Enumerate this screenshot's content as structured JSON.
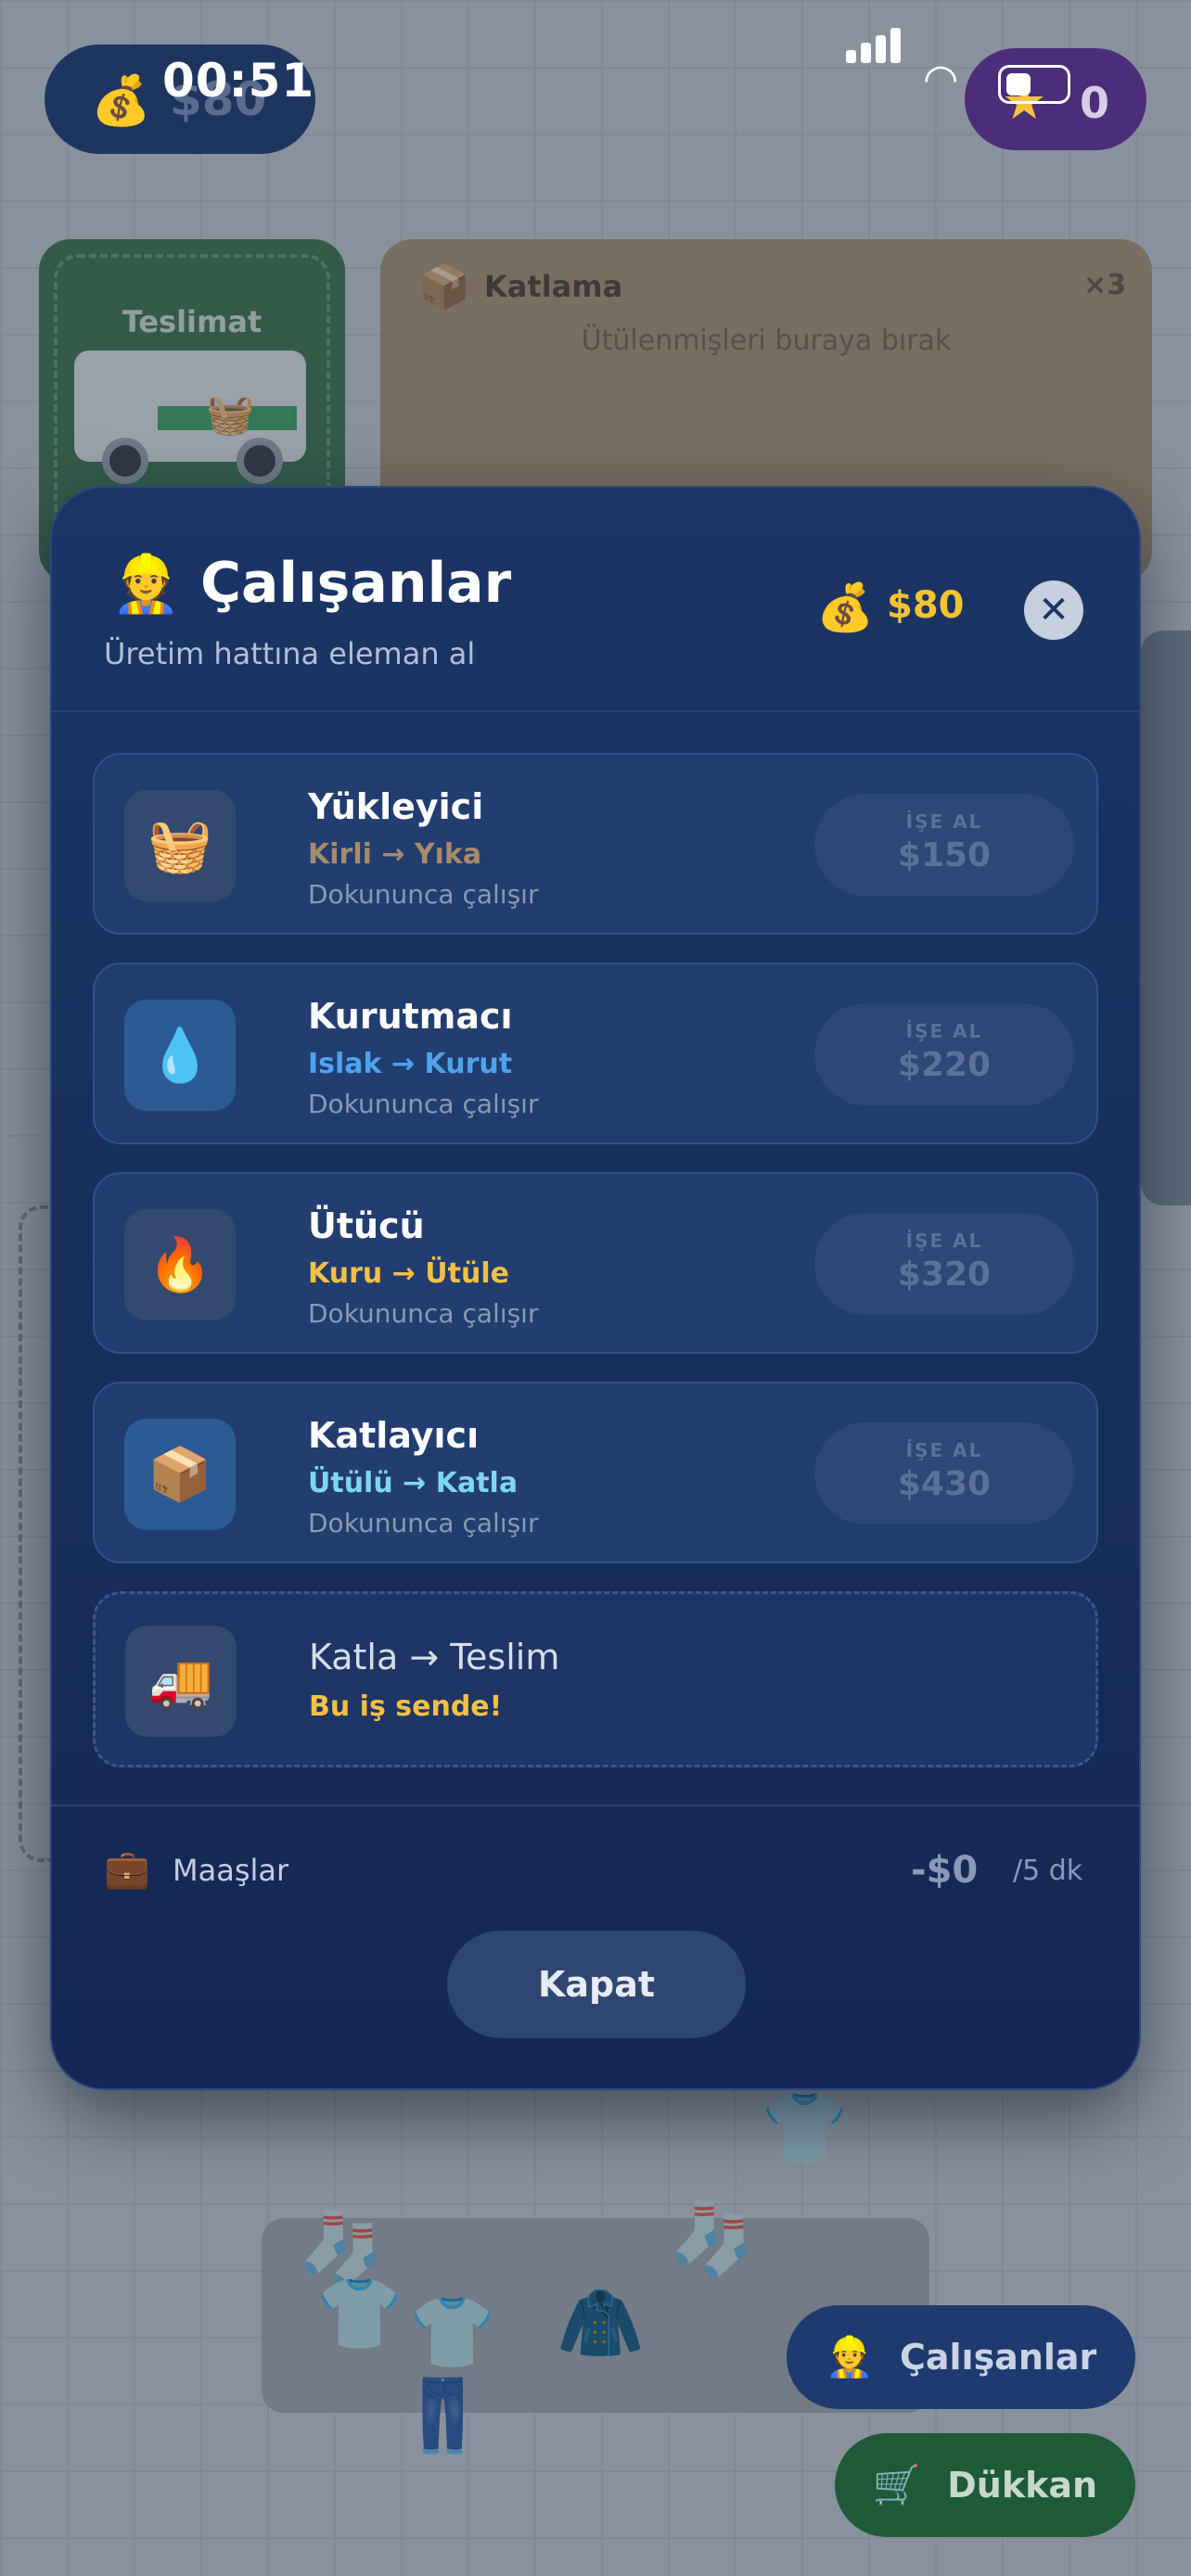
{
  "status_bar": {
    "time": "00:51",
    "money_ghost": "$80",
    "stars": "0"
  },
  "background": {
    "delivery_title": "Teslimat",
    "folding_title": "Katlama",
    "folding_multiplier": "×3",
    "folding_hint": "Ütülenmişleri buraya bırak"
  },
  "modal": {
    "title": "Çalışanlar",
    "subtitle": "Üretim hattına eleman al",
    "money": "$80",
    "close_symbol": "✕",
    "workers": [
      {
        "icon": "basket-icon",
        "glyph": "🧺",
        "name": "Yükleyici",
        "flow": "Kirli → Yıka",
        "flow_color": "#a78b6a",
        "note": "Dokununca çalışır",
        "hire_label": "İŞE AL",
        "price": "$150"
      },
      {
        "icon": "droplet-icon",
        "glyph": "💧",
        "name": "Kurutmacı",
        "flow": "Islak → Kurut",
        "flow_color": "#4ea3ee",
        "note": "Dokununca çalışır",
        "hire_label": "İŞE AL",
        "price": "$220"
      },
      {
        "icon": "fire-icon",
        "glyph": "🔥",
        "name": "Ütücü",
        "flow": "Kuru → Ütüle",
        "flow_color": "#f2c042",
        "note": "Dokununca çalışır",
        "hire_label": "İŞE AL",
        "price": "$320"
      },
      {
        "icon": "box-icon",
        "glyph": "📦",
        "name": "Katlayıcı",
        "flow": "Ütülü → Katla",
        "flow_color": "#7fd6f2",
        "note": "Dokununca çalışır",
        "hire_label": "İŞE AL",
        "price": "$430"
      }
    ],
    "self_task": {
      "icon": "truck-icon",
      "glyph": "🚚",
      "flow": "Katla → Teslim",
      "note": "Bu iş sende!"
    },
    "salaries_label": "Maaşlar",
    "salaries_amount": "-$0",
    "salaries_period": "/5 dk",
    "close_button": "Kapat"
  },
  "fabs": {
    "workers": "Çalışanlar",
    "shop": "Dükkan"
  }
}
